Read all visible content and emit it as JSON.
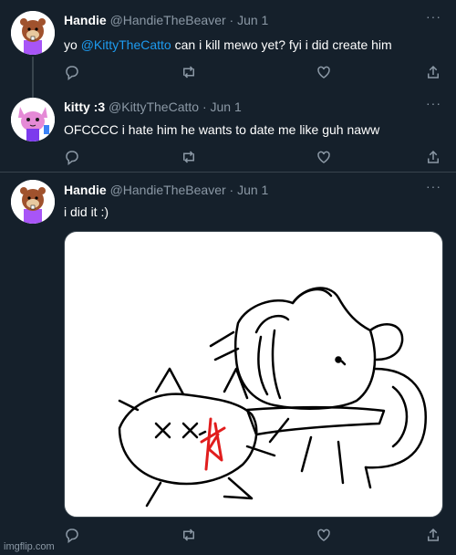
{
  "tweets": [
    {
      "name": "Handie",
      "handle": "@HandieTheBeaver",
      "separator": "·",
      "date": "Jun 1",
      "text_before": "yo ",
      "mention": "@KittyTheCatto",
      "text_after": " can i kill mewo yet? fyi i did create him",
      "avatar_icon": "beaver-avatar"
    },
    {
      "name": "kitty :3",
      "handle": "@KittyTheCatto",
      "separator": "·",
      "date": "Jun 1",
      "text": "OFCCCC i hate him he wants to date me like guh naww",
      "avatar_icon": "pink-cat-avatar"
    },
    {
      "name": "Handie",
      "handle": "@HandieTheBeaver",
      "separator": "·",
      "date": "Jun 1",
      "text": "i did it :)",
      "avatar_icon": "beaver-avatar"
    }
  ],
  "more_label": "···",
  "watermark": "imgflip.com",
  "colors": {
    "background": "#15202b",
    "accent": "#1d9bf0",
    "muted": "#8b98a5",
    "border": "#38444d"
  }
}
